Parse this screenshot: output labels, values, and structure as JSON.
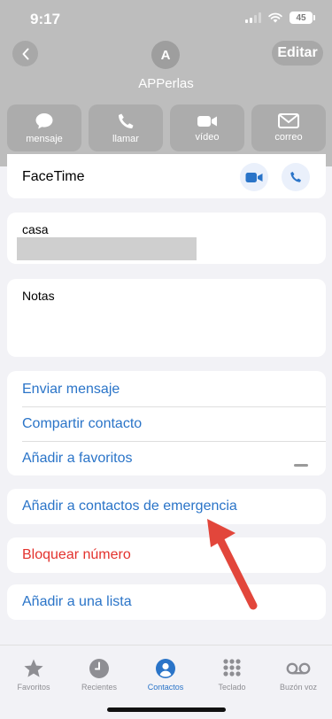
{
  "status": {
    "time": "9:17",
    "battery": "45"
  },
  "header": {
    "back_icon": "chevron-left-icon",
    "edit_label": "Editar",
    "avatar_initial": "A",
    "contact_name": "APPerlas"
  },
  "actions": [
    {
      "label": "mensaje",
      "icon": "message-bubble-icon"
    },
    {
      "label": "llamar",
      "icon": "phone-icon"
    },
    {
      "label": "vídeo",
      "icon": "video-camera-icon"
    },
    {
      "label": "correo",
      "icon": "mail-envelope-icon"
    }
  ],
  "facetime": {
    "label": "FaceTime"
  },
  "phone_field": {
    "label": "casa"
  },
  "notes": {
    "label": "Notas"
  },
  "links": [
    "Enviar mensaje",
    "Compartir contacto",
    "Añadir a favoritos"
  ],
  "emergency": {
    "label": "Añadir a contactos de emergencia"
  },
  "block": {
    "label": "Bloquear número"
  },
  "add_list": {
    "label": "Añadir a una lista"
  },
  "tabs": [
    {
      "label": "Favoritos",
      "icon": "star-icon"
    },
    {
      "label": "Recientes",
      "icon": "clock-icon"
    },
    {
      "label": "Contactos",
      "icon": "person-circle-icon",
      "active": true
    },
    {
      "label": "Teclado",
      "icon": "keypad-icon"
    },
    {
      "label": "Buzón voz",
      "icon": "voicemail-icon"
    }
  ],
  "colors": {
    "accent": "#2a74c8",
    "destructive": "#e3322d",
    "arrow": "#e2463b"
  }
}
